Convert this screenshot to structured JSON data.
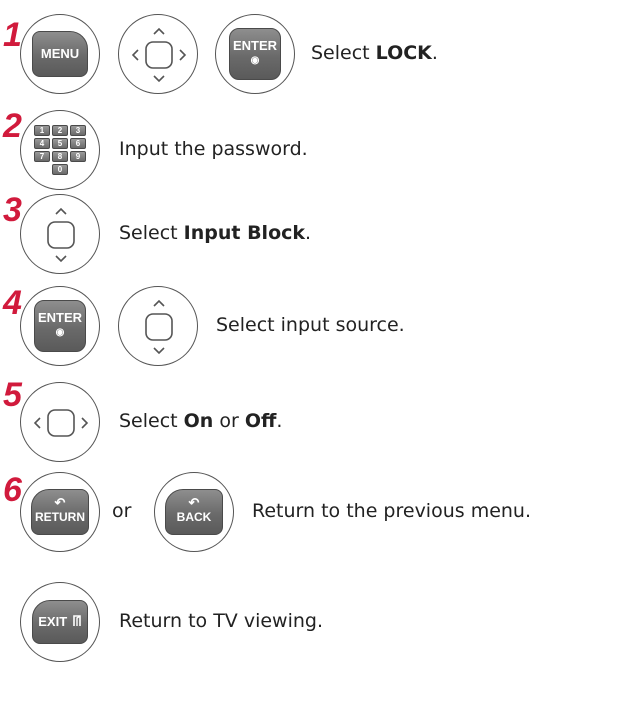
{
  "steps": [
    {
      "number": "1",
      "keys": [
        "MENU",
        "nav",
        "ENTER"
      ],
      "text_pre": "Select ",
      "text_bold": "LOCK",
      "text_post": "."
    },
    {
      "number": "2",
      "keys": [
        "numpad"
      ],
      "text": "Input the password."
    },
    {
      "number": "3",
      "keys": [
        "nav"
      ],
      "text_pre": "Select ",
      "text_bold": "Input Block",
      "text_post": "."
    },
    {
      "number": "4",
      "keys": [
        "ENTER",
        "nav"
      ],
      "text": "Select input source."
    },
    {
      "number": "5",
      "keys": [
        "nav"
      ],
      "text_pre": "Select ",
      "text_bold": "On",
      "text_mid": " or ",
      "text_bold2": "Off",
      "text_post": "."
    },
    {
      "number": "6",
      "keys": [
        "RETURN",
        "BACK"
      ],
      "or_label": "or",
      "text": "Return to the previous menu."
    },
    {
      "keys": [
        "EXIT"
      ],
      "text": "Return to TV viewing."
    }
  ],
  "labels": {
    "menu": "MENU",
    "enter": "ENTER",
    "enter_dot": "◉",
    "return": "RETURN",
    "back": "BACK",
    "exit": "EXIT",
    "return_icon": "↶"
  },
  "numpad": [
    [
      "1",
      "2",
      "3"
    ],
    [
      "4",
      "5",
      "6"
    ],
    [
      "7",
      "8",
      "9"
    ],
    [
      "0"
    ]
  ],
  "colors": {
    "step_number": "#d11a3c",
    "key_fill": "#6a6a6a",
    "circle_border": "#555555"
  },
  "icons": {
    "nav": "navigation-pad-icon",
    "exit": "exit-door-icon",
    "return": "return-arrow-icon"
  }
}
